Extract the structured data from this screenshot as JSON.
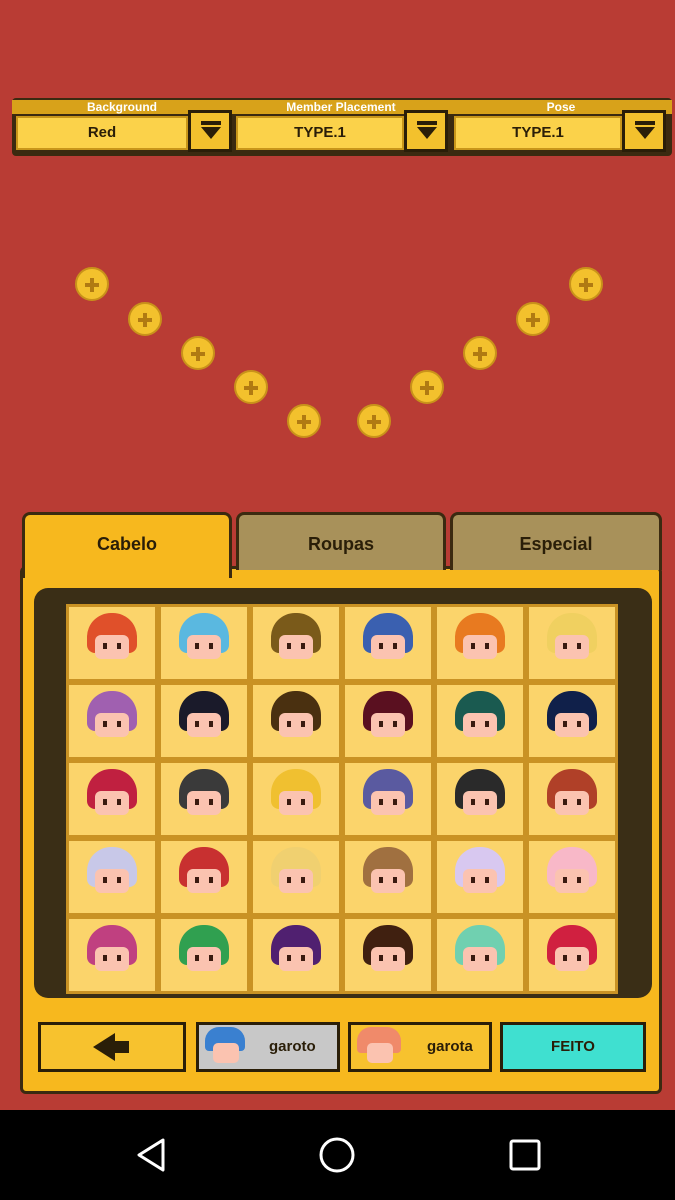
{
  "dropdowns": [
    {
      "label": "Background",
      "value": "Red"
    },
    {
      "label": "Member Placement",
      "value": "TYPE.1"
    },
    {
      "label": "Pose",
      "value": "TYPE.1"
    }
  ],
  "tabs": [
    "Cabelo",
    "Roupas",
    "Especial"
  ],
  "bottom_buttons": {
    "boy_label": "garoto",
    "girl_label": "garota",
    "done_label": "FEITO"
  },
  "colors": {
    "background": "#b93c34",
    "accent": "#f7b81e",
    "done": "#3fe0d0"
  },
  "hair_colors": [
    "#e0502a",
    "#5ab8e0",
    "#7a5a1a",
    "#3a60b0",
    "#e87a20",
    "#f0d060",
    "#a060b0",
    "#1a1a2a",
    "#4a3010",
    "#5a1020",
    "#1a5a50",
    "#10204a",
    "#c02040",
    "#3a3a3a",
    "#f0c030",
    "#5a5aa0",
    "#2a2a2a",
    "#b04028",
    "#c8c8e8",
    "#c83030",
    "#f0d070",
    "#a07040",
    "#d8c8f0",
    "#f8b8c8",
    "#c04080",
    "#30a050",
    "#502070",
    "#402010",
    "#70d0b0",
    "#d02040"
  ]
}
